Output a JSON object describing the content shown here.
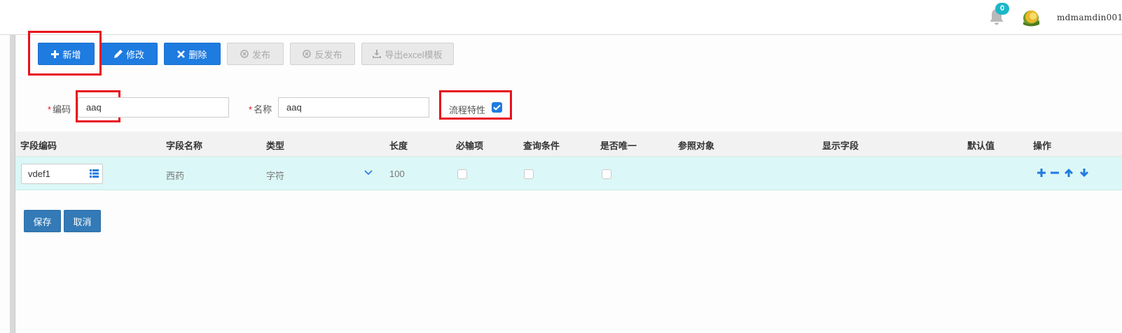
{
  "header": {
    "notification_count": "0",
    "username": "mdmamdin001"
  },
  "toolbar": {
    "add_label": "新增",
    "edit_label": "修改",
    "delete_label": "删除",
    "publish_label": "发布",
    "unpublish_label": "反发布",
    "export_label": "导出excel模板"
  },
  "form": {
    "code_label": "编码",
    "code_value": "aaq",
    "name_label": "名称",
    "name_value": "aaq",
    "process_label": "流程特性",
    "process_checked": true,
    "required_mark": "*"
  },
  "table": {
    "columns": [
      "字段编码",
      "字段名称",
      "类型",
      "长度",
      "必输项",
      "查询条件",
      "是否唯一",
      "参照对象",
      "显示字段",
      "默认值",
      "操作"
    ],
    "rows": [
      {
        "field_code": "vdef1",
        "field_name": "西药",
        "type": "字符",
        "length": "100",
        "required": false,
        "query_condition": false,
        "unique": false,
        "reference": "",
        "display_field": "",
        "default_value": ""
      }
    ],
    "ops": [
      "plus-icon",
      "minus-icon",
      "arrow-up-icon",
      "arrow-down-icon"
    ]
  },
  "footer": {
    "save_label": "保存",
    "cancel_label": "取消"
  },
  "colors": {
    "primary": "#1e7be0",
    "highlight_box": "#e8101d",
    "row_bg": "#dcf7f7",
    "badge": "#1cb8c8"
  }
}
